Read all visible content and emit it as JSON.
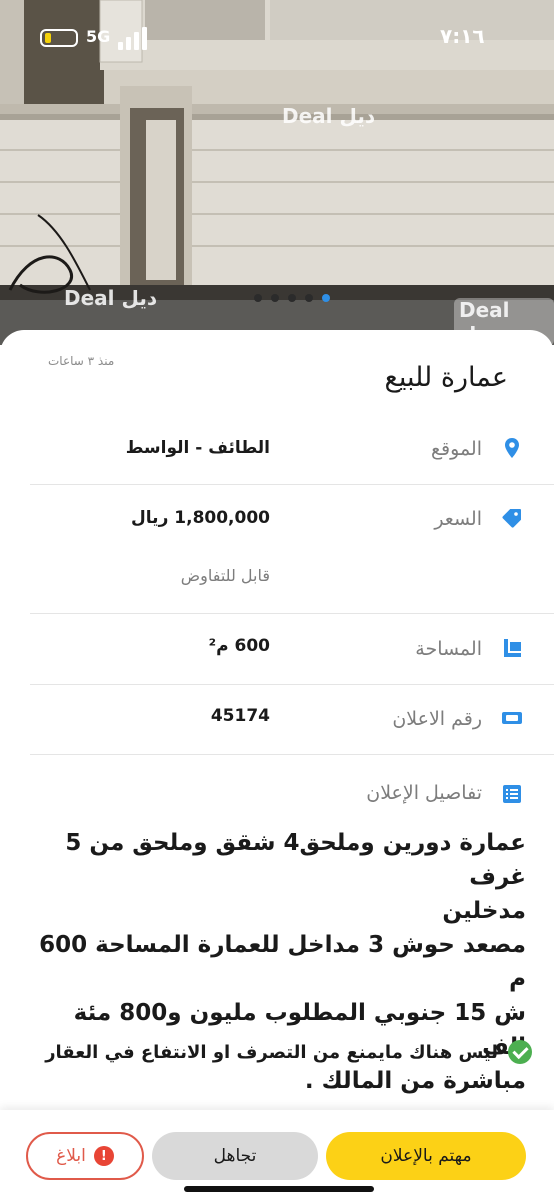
{
  "status_bar": {
    "time": "٧:١٦",
    "network": "5G"
  },
  "hero": {
    "watermark": "Deal ديل",
    "slides_count": 5,
    "active_slide_index": 4
  },
  "listing": {
    "posted": "منذ ٣ ساعات",
    "title": "عمارة للبيع",
    "location": {
      "label": "الموقع",
      "value": "الطائف - الواسط"
    },
    "price": {
      "label": "السعر",
      "value": "1,800,000 ريال",
      "note": "قابل للتفاوض"
    },
    "area": {
      "label": "المساحة",
      "value": "600 م²"
    },
    "ad_number": {
      "label": "رقم الاعلان",
      "value": "45174"
    },
    "details": {
      "label": "تفاصيل الإعلان"
    },
    "description": "عمارة دورين وملحق4 شقق وملحق من 5 غرف\nمدخلين\nمصعد حوش 3 مداخل للعمارة المساحة 600 م\nش 15 جنوبي المطلوب مليون و800 مئة الف\nمباشرة من المالك .",
    "legal_note": "ليس هناك مايمنع من التصرف او الانتفاع في العقار"
  },
  "actions": {
    "interested": "مهتم بالإعلان",
    "ignore": "تجاهل",
    "report": "ابلاغ"
  },
  "colors": {
    "accent": "#2f8fe6",
    "primary_button": "#fcd116",
    "report": "#e05a4a",
    "check": "#4caf50"
  },
  "icons": [
    "location-pin-icon",
    "price-tag-icon",
    "area-icon",
    "ad-number-icon",
    "details-list-icon",
    "check-circle-icon",
    "alert-icon"
  ]
}
